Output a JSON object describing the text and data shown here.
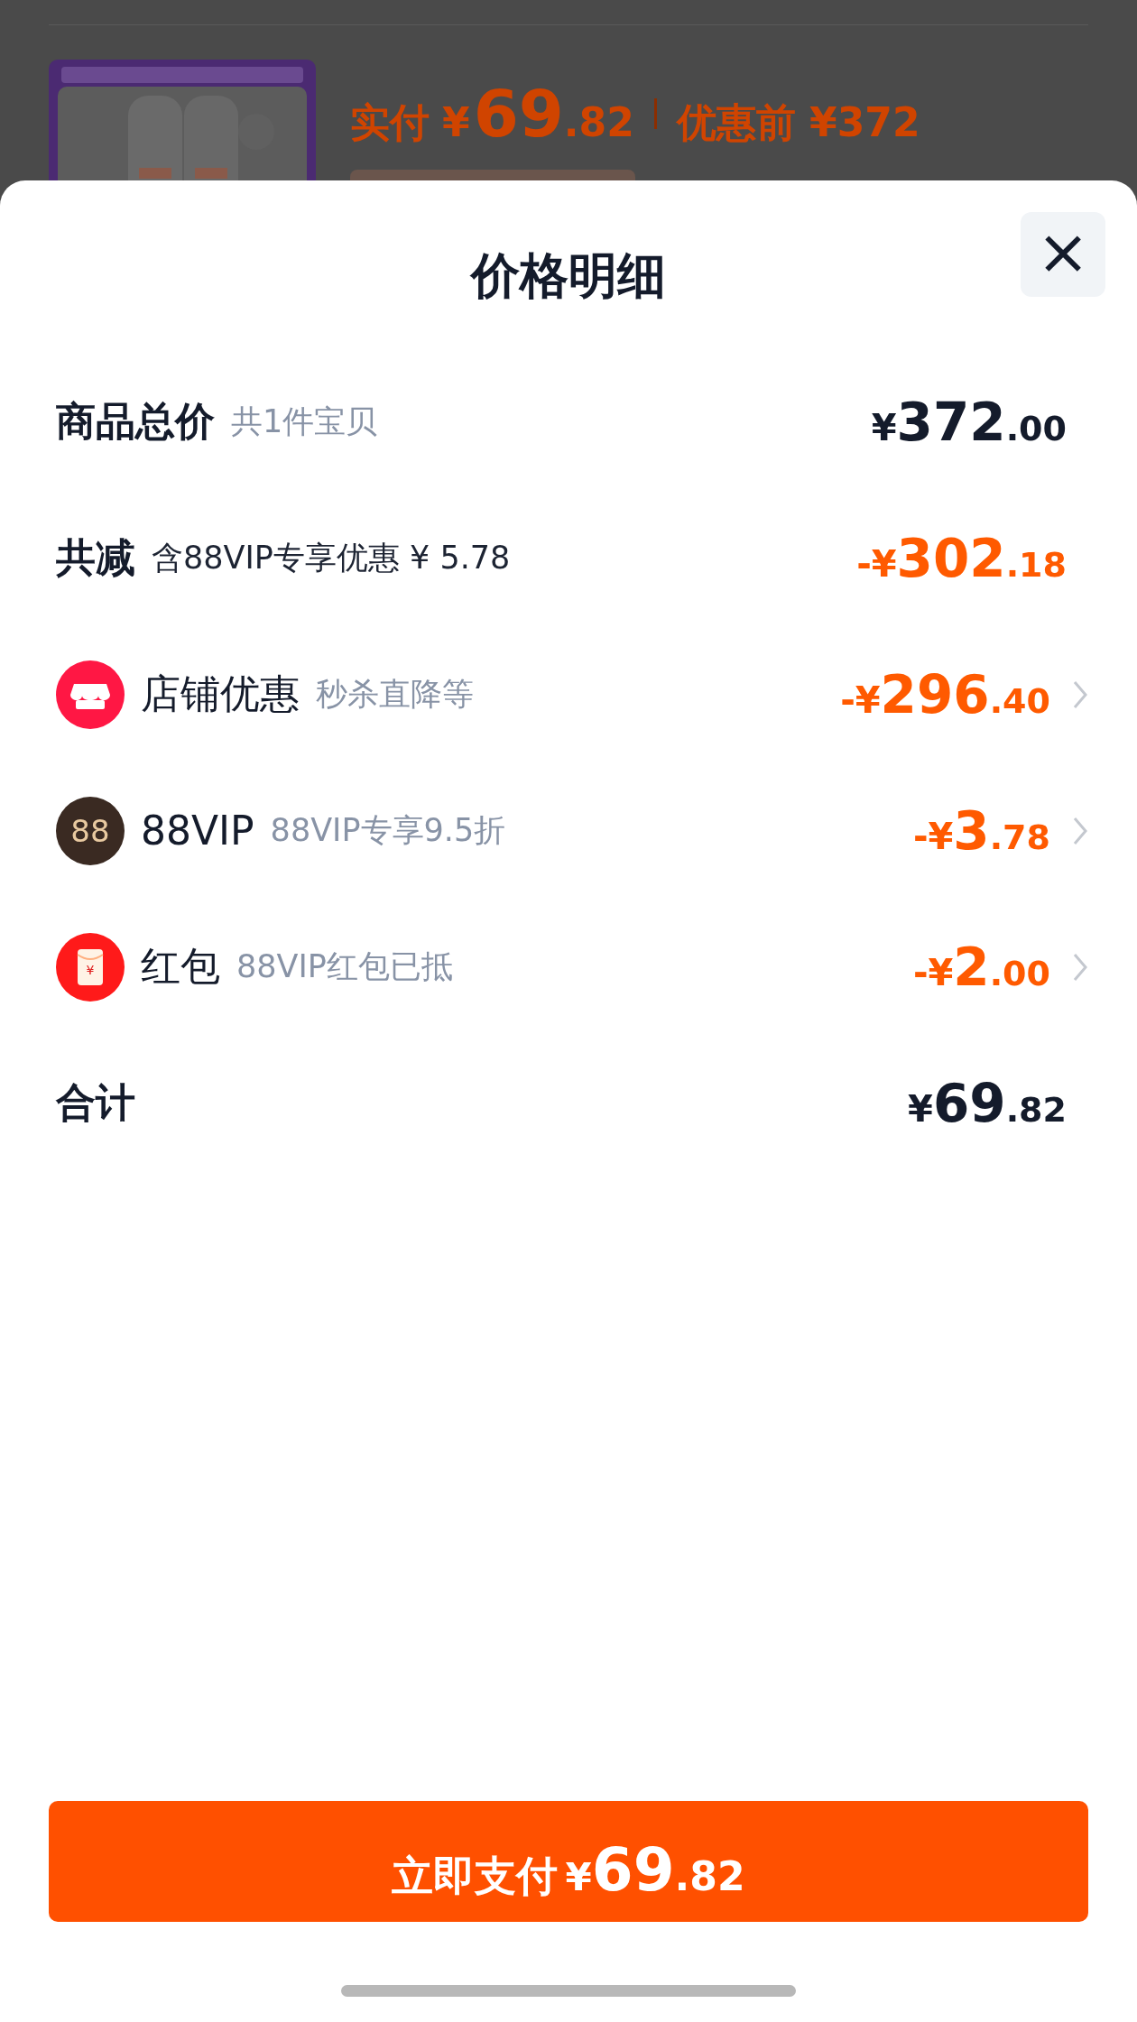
{
  "background": {
    "paid_label": "实付",
    "paid_amount": {
      "prefix": "¥",
      "main": "69",
      "decimal": ".82"
    },
    "original_price": "优惠前 ¥372"
  },
  "sheet": {
    "title": "价格明细",
    "close_icon": "×",
    "rows": [
      {
        "kind": "total",
        "label": "商品总价",
        "note": "共1件宝贝",
        "amount": {
          "prefix": "¥",
          "main": "372",
          "decimal": ".00"
        }
      },
      {
        "kind": "discount",
        "label": "共减",
        "note": "含88VIP专享优惠 ¥ 5.78",
        "amount": {
          "prefix": "-¥",
          "main": "302",
          "decimal": ".18"
        }
      },
      {
        "kind": "store",
        "label": "店铺优惠",
        "note": "秒杀直降等",
        "amount": {
          "prefix": "-¥",
          "main": "296",
          "decimal": ".40"
        }
      },
      {
        "kind": "vip",
        "icon_text": "88",
        "label": "88VIP",
        "note": "88VIP专享9.5折",
        "amount": {
          "prefix": "-¥",
          "main": "3",
          "decimal": ".78"
        }
      },
      {
        "kind": "packet",
        "icon_text": "¥",
        "label": "红包",
        "note": "88VIP红包已抵",
        "amount": {
          "prefix": "-¥",
          "main": "2",
          "decimal": ".00"
        }
      },
      {
        "kind": "sum",
        "label": "合计",
        "amount": {
          "prefix": "¥",
          "main": "69",
          "decimal": ".82"
        }
      }
    ],
    "pay_button": {
      "label": "立即支付",
      "amount": {
        "prefix": "¥",
        "main": "69",
        "decimal": ".82"
      }
    }
  }
}
